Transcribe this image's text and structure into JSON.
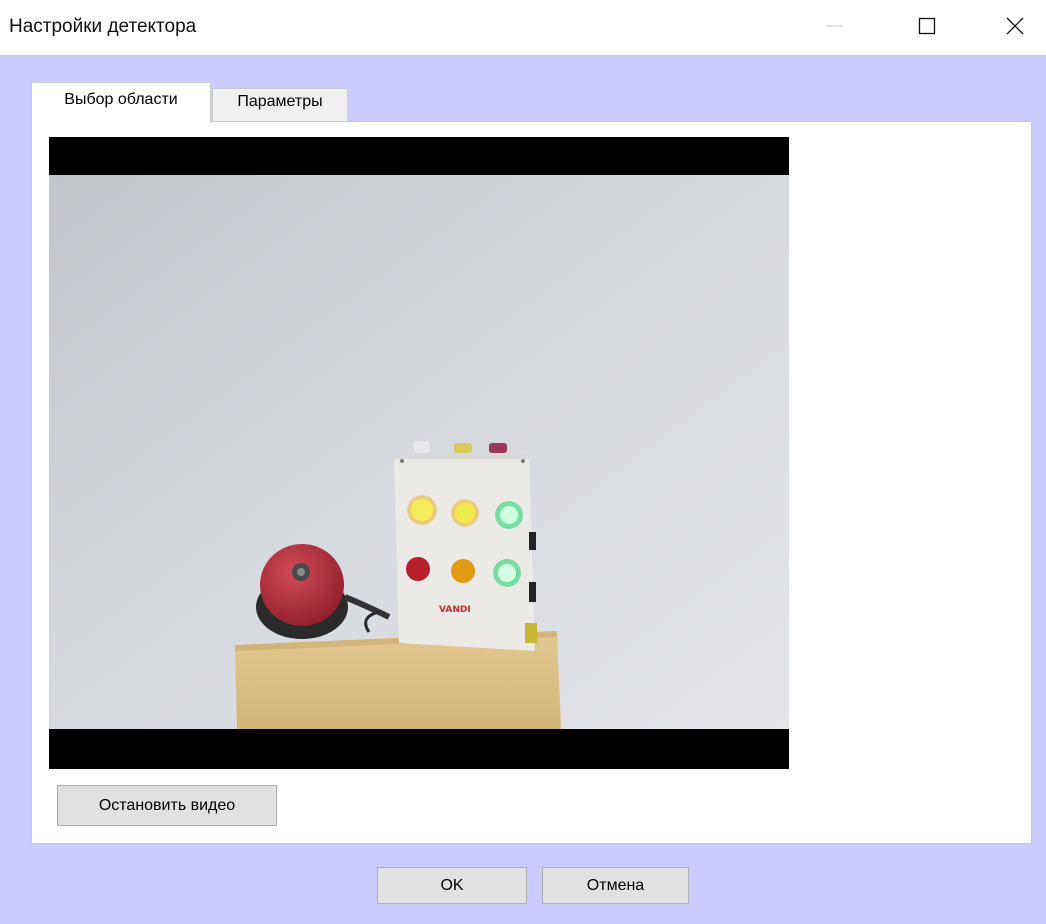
{
  "window": {
    "title": "Настройки детектора",
    "controls": {
      "minimize_icon": "minimize-icon",
      "maximize_icon": "maximize-icon",
      "close_icon": "close-icon"
    }
  },
  "tabs": [
    {
      "label": "Выбор области",
      "active": true
    },
    {
      "label": "Параметры",
      "active": false
    }
  ],
  "video": {
    "logo_text": "VANDI"
  },
  "buttons": {
    "stop_video": "Остановить видео",
    "ok": "OK",
    "cancel": "Отмена"
  },
  "colors": {
    "client_background": "#cccbff",
    "panel_background": "#ffffff",
    "button_background": "#e1e1e1"
  }
}
